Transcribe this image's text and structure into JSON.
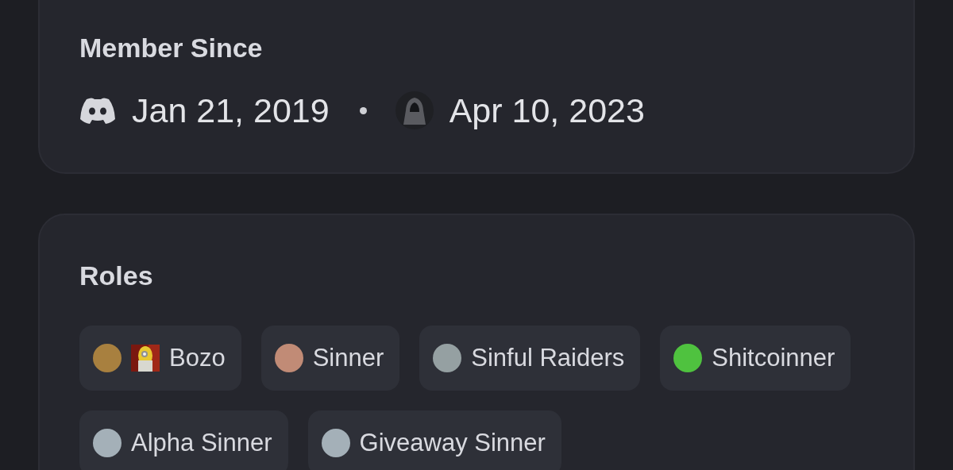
{
  "member_since": {
    "title": "Member Since",
    "dates": [
      {
        "kind": "discord",
        "text": "Jan 21, 2019"
      },
      {
        "kind": "server",
        "text": "Apr 10, 2023"
      }
    ]
  },
  "roles": {
    "title": "Roles",
    "items": [
      {
        "name": "Bozo",
        "color": "#a8803f"
      },
      {
        "name": "Sinner",
        "color": "#c18b76"
      },
      {
        "name": "Sinful Raiders",
        "color": "#95a0a2"
      },
      {
        "name": "Shitcoinner",
        "color": "#4fc23f"
      },
      {
        "name": "Alpha Sinner",
        "color": "#a4b0b8"
      },
      {
        "name": "Giveaway Sinner",
        "color": "#a4b0b8"
      }
    ]
  }
}
